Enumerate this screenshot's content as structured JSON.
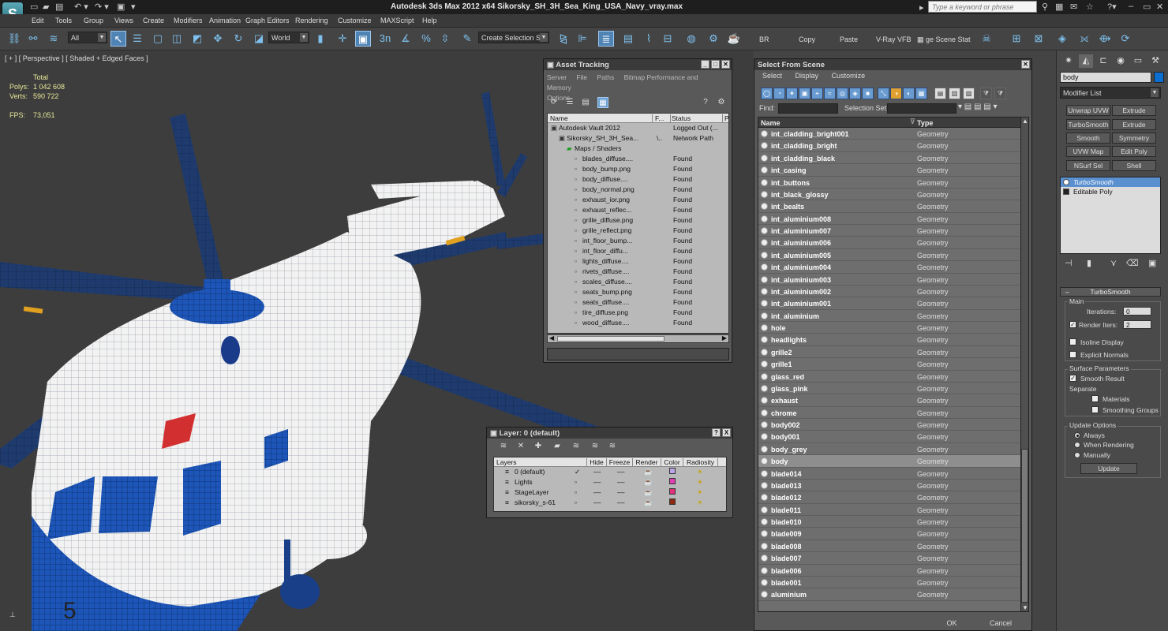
{
  "app": {
    "title": "Autodesk 3ds Max  2012 x64    Sikorsky_SH_3H_Sea_King_USA_Navy_vray.max",
    "logo": "3ds-max-logo",
    "search_placeholder": "Type a keyword or phrase"
  },
  "menu": [
    "Edit",
    "Tools",
    "Group",
    "Views",
    "Create",
    "Modifiers",
    "Animation",
    "Graph Editors",
    "Rendering",
    "Customize",
    "MAXScript",
    "Help"
  ],
  "toolbar": {
    "selection_filter": "All",
    "ref_coord": "World",
    "snaps": [
      "3",
      "n"
    ],
    "named_selection": "Create Selection Se",
    "br": "BR",
    "copy": "Copy",
    "paste": "Paste",
    "vray_vfb": "V-Ray VFB",
    "scene_state": "ge Scene Stat"
  },
  "viewport": {
    "label": "[ + ] [ Perspective ] [ Shaded + Edged Faces ]",
    "stats_total_label": "Total",
    "polys_label": "Polys:",
    "polys_value": "1 042 608",
    "verts_label": "Verts:",
    "verts_value": "590 722",
    "fps_label": "FPS:",
    "fps_value": "73,051",
    "tail_number": "5"
  },
  "asset_tracking": {
    "title": "Asset Tracking",
    "menu": [
      "Server",
      "File",
      "Paths",
      "Bitmap Performance and Memory"
    ],
    "options": "Options",
    "columns": [
      "Name",
      "F...",
      "Status",
      "P"
    ],
    "rows": [
      {
        "name": "Autodesk Vault 2012",
        "f": "",
        "status": "Logged Out (...",
        "indent": 0
      },
      {
        "name": "Sikorsky_SH_3H_Sea...",
        "f": "\\..",
        "status": "Network Path",
        "indent": 1
      },
      {
        "name": "Maps / Shaders",
        "f": "",
        "status": "",
        "indent": 2
      },
      {
        "name": "blades_diffuse....",
        "f": "",
        "status": "Found",
        "indent": 3
      },
      {
        "name": "body_bump.png",
        "f": "",
        "status": "Found",
        "indent": 3
      },
      {
        "name": "body_diffuse....",
        "f": "",
        "status": "Found",
        "indent": 3
      },
      {
        "name": "body_normal.png",
        "f": "",
        "status": "Found",
        "indent": 3
      },
      {
        "name": "exhaust_ior.png",
        "f": "",
        "status": "Found",
        "indent": 3
      },
      {
        "name": "exhaust_reflec...",
        "f": "",
        "status": "Found",
        "indent": 3
      },
      {
        "name": "grille_diffuse.png",
        "f": "",
        "status": "Found",
        "indent": 3
      },
      {
        "name": "grille_reflect.png",
        "f": "",
        "status": "Found",
        "indent": 3
      },
      {
        "name": "int_floor_bump...",
        "f": "",
        "status": "Found",
        "indent": 3
      },
      {
        "name": "int_floor_diffu...",
        "f": "",
        "status": "Found",
        "indent": 3
      },
      {
        "name": "lights_diffuse....",
        "f": "",
        "status": "Found",
        "indent": 3
      },
      {
        "name": "rivets_diffuse....",
        "f": "",
        "status": "Found",
        "indent": 3
      },
      {
        "name": "scales_diffuse....",
        "f": "",
        "status": "Found",
        "indent": 3
      },
      {
        "name": "seats_bump.png",
        "f": "",
        "status": "Found",
        "indent": 3
      },
      {
        "name": "seats_diffuse....",
        "f": "",
        "status": "Found",
        "indent": 3
      },
      {
        "name": "tire_diffuse.png",
        "f": "",
        "status": "Found",
        "indent": 3
      },
      {
        "name": "wood_diffuse....",
        "f": "",
        "status": "Found",
        "indent": 3
      }
    ]
  },
  "layer": {
    "title": "Layer: 0 (default)",
    "columns": [
      "Layers",
      "Hide",
      "Freeze",
      "Render",
      "Color",
      "Radiosity"
    ],
    "rows": [
      {
        "name": "0 (default)",
        "color": "#b8a6e6",
        "current": true
      },
      {
        "name": "Lights",
        "color": "#e23fb5",
        "current": false
      },
      {
        "name": "StageLayer",
        "color": "#e2307a",
        "current": false
      },
      {
        "name": "sikorsky_s-61",
        "color": "#8a2a10",
        "current": false
      }
    ],
    "help": "?",
    "close": "X"
  },
  "select_from_scene": {
    "title": "Select From Scene",
    "menu": [
      "Select",
      "Display",
      "Customize"
    ],
    "find_label": "Find:",
    "selection_set_label": "Selection Set:",
    "col_name": "Name",
    "col_type": "Type",
    "rows": [
      {
        "name": "int_cladding_bright001",
        "type": "Geometry"
      },
      {
        "name": "int_cladding_bright",
        "type": "Geometry"
      },
      {
        "name": "int_cladding_black",
        "type": "Geometry"
      },
      {
        "name": "int_casing",
        "type": "Geometry"
      },
      {
        "name": "int_buttons",
        "type": "Geometry"
      },
      {
        "name": "int_black_glossy",
        "type": "Geometry"
      },
      {
        "name": "int_bealts",
        "type": "Geometry"
      },
      {
        "name": "int_aluminium008",
        "type": "Geometry"
      },
      {
        "name": "int_aluminium007",
        "type": "Geometry"
      },
      {
        "name": "int_aluminium006",
        "type": "Geometry"
      },
      {
        "name": "int_aluminium005",
        "type": "Geometry"
      },
      {
        "name": "int_aluminium004",
        "type": "Geometry"
      },
      {
        "name": "int_aluminium003",
        "type": "Geometry"
      },
      {
        "name": "int_aluminium002",
        "type": "Geometry"
      },
      {
        "name": "int_aluminium001",
        "type": "Geometry"
      },
      {
        "name": "int_aluminium",
        "type": "Geometry"
      },
      {
        "name": "hole",
        "type": "Geometry"
      },
      {
        "name": "headlights",
        "type": "Geometry"
      },
      {
        "name": "grille2",
        "type": "Geometry"
      },
      {
        "name": "grille1",
        "type": "Geometry"
      },
      {
        "name": "glass_red",
        "type": "Geometry"
      },
      {
        "name": "glass_pink",
        "type": "Geometry"
      },
      {
        "name": "exhaust",
        "type": "Geometry"
      },
      {
        "name": "chrome",
        "type": "Geometry"
      },
      {
        "name": "body002",
        "type": "Geometry"
      },
      {
        "name": "body001",
        "type": "Geometry"
      },
      {
        "name": "body_grey",
        "type": "Geometry"
      },
      {
        "name": "body",
        "type": "Geometry",
        "selected": true
      },
      {
        "name": "blade014",
        "type": "Geometry"
      },
      {
        "name": "blade013",
        "type": "Geometry"
      },
      {
        "name": "blade012",
        "type": "Geometry"
      },
      {
        "name": "blade011",
        "type": "Geometry"
      },
      {
        "name": "blade010",
        "type": "Geometry"
      },
      {
        "name": "blade009",
        "type": "Geometry"
      },
      {
        "name": "blade008",
        "type": "Geometry"
      },
      {
        "name": "blade007",
        "type": "Geometry"
      },
      {
        "name": "blade006",
        "type": "Geometry"
      },
      {
        "name": "blade001",
        "type": "Geometry"
      },
      {
        "name": "aluminium",
        "type": "Geometry"
      }
    ],
    "ok": "OK",
    "cancel": "Cancel"
  },
  "command_panel": {
    "object_name": "body",
    "object_color": "#0b6fd1",
    "modifier_list": "Modifier List",
    "buttons": [
      "Unwrap UVW",
      "Extrude",
      "TurboSmooth",
      "Extrude",
      "Smooth",
      "Symmetry",
      "UVW Map",
      "Edit Poly",
      "NSurf Sel",
      "Shell"
    ],
    "stack": [
      "TurboSmooth",
      "Editable Poly"
    ],
    "rollout_title": "TurboSmooth",
    "main_label": "Main",
    "iterations_label": "Iterations:",
    "iterations_value": "0",
    "render_iters_label": "Render Iters:",
    "render_iters_value": "2",
    "isoline_label": "Isoline Display",
    "explicit_normals_label": "Explicit Normals",
    "surface_params_label": "Surface Parameters",
    "smooth_result_label": "Smooth Result",
    "separate_label": "Separate",
    "materials_label": "Materials",
    "smoothing_groups_label": "Smoothing Groups",
    "update_options_label": "Update Options",
    "always_label": "Always",
    "when_rendering_label": "When Rendering",
    "manually_label": "Manually",
    "update_button": "Update"
  }
}
